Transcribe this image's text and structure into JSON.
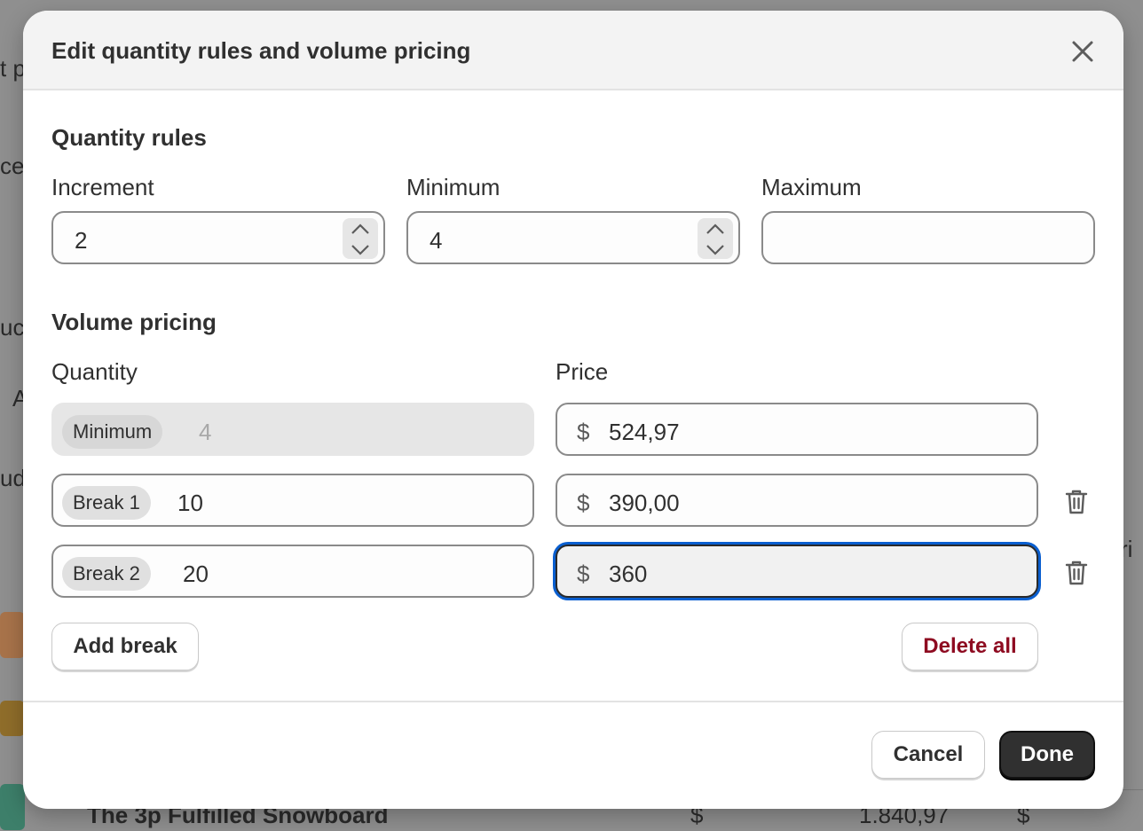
{
  "background": {
    "fragments": [
      "t p",
      "ce",
      "uc",
      "A",
      "ude",
      "ri"
    ],
    "bottom_row": {
      "title": "The 3p Fulfilled Snowboard",
      "currency": "$",
      "value": "1.840,97",
      "currency2": "$"
    }
  },
  "modal": {
    "title": "Edit quantity rules and volume pricing",
    "close_icon": "close-icon"
  },
  "quantity_rules": {
    "heading": "Quantity rules",
    "increment": {
      "label": "Increment",
      "value": "2"
    },
    "minimum": {
      "label": "Minimum",
      "value": "4"
    },
    "maximum": {
      "label": "Maximum",
      "value": ""
    }
  },
  "volume_pricing": {
    "heading": "Volume pricing",
    "quantity_header": "Quantity",
    "price_header": "Price",
    "currency_symbol": "$",
    "rows": [
      {
        "pill": "Minimum",
        "quantity": "4",
        "price": "524,97",
        "disabled": true
      },
      {
        "pill": "Break 1",
        "quantity": "10",
        "price": "390,00",
        "disabled": false
      },
      {
        "pill": "Break 2",
        "quantity": "20",
        "price": "360",
        "disabled": false,
        "focused": true
      }
    ],
    "add_break_label": "Add break",
    "delete_all_label": "Delete all"
  },
  "footer": {
    "cancel_label": "Cancel",
    "done_label": "Done"
  },
  "colors": {
    "accent_focus": "#0a5fd0",
    "danger_text": "#8e0b21",
    "primary_button": "#303030"
  }
}
